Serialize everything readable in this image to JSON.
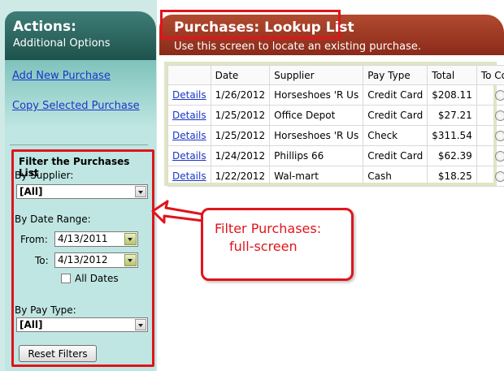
{
  "sidebar": {
    "header_title": "Actions:",
    "header_subtitle": "Additional Options",
    "links": {
      "add_new": "Add New Purchase",
      "copy_selected": "Copy Selected Purchase"
    },
    "filter": {
      "title": "Filter the Purchases List",
      "supplier_label": "By Supplier:",
      "supplier_value": "[All]",
      "date_range_label": "By Date Range:",
      "from_label": "From:",
      "from_value": "4/13/2011",
      "to_label": "To:",
      "to_value": "4/13/2012",
      "all_dates_label": "All Dates",
      "pay_type_label": "By Pay Type:",
      "pay_type_value": "[All]",
      "reset_label": "Reset Filters"
    }
  },
  "main": {
    "title": "Purchases: Lookup List",
    "subtitle": "Use this screen to locate an existing purchase.",
    "table": {
      "headers": [
        "",
        "Date",
        "Supplier",
        "Pay Type",
        "Total",
        "To Copy"
      ],
      "rows": [
        {
          "link": "Details",
          "date": "1/26/2012",
          "supplier": "Horseshoes 'R Us",
          "pay_type": "Credit Card",
          "total": "$208.11"
        },
        {
          "link": "Details",
          "date": "1/25/2012",
          "supplier": "Office Depot",
          "pay_type": "Credit Card",
          "total": "$27.21"
        },
        {
          "link": "Details",
          "date": "1/25/2012",
          "supplier": "Horseshoes 'R Us",
          "pay_type": "Check",
          "total": "$311.54"
        },
        {
          "link": "Details",
          "date": "1/24/2012",
          "supplier": "Phillips 66",
          "pay_type": "Credit Card",
          "total": "$62.39"
        },
        {
          "link": "Details",
          "date": "1/22/2012",
          "supplier": "Wal-mart",
          "pay_type": "Cash",
          "total": "$18.25"
        }
      ]
    }
  },
  "callout": {
    "line1": "Filter Purchases:",
    "line2": "full-screen"
  },
  "colors": {
    "sidebar_header": "#1e524c",
    "main_header": "#8a2a1a",
    "highlight_red": "#e0141b",
    "link_blue": "#1a36c8"
  }
}
